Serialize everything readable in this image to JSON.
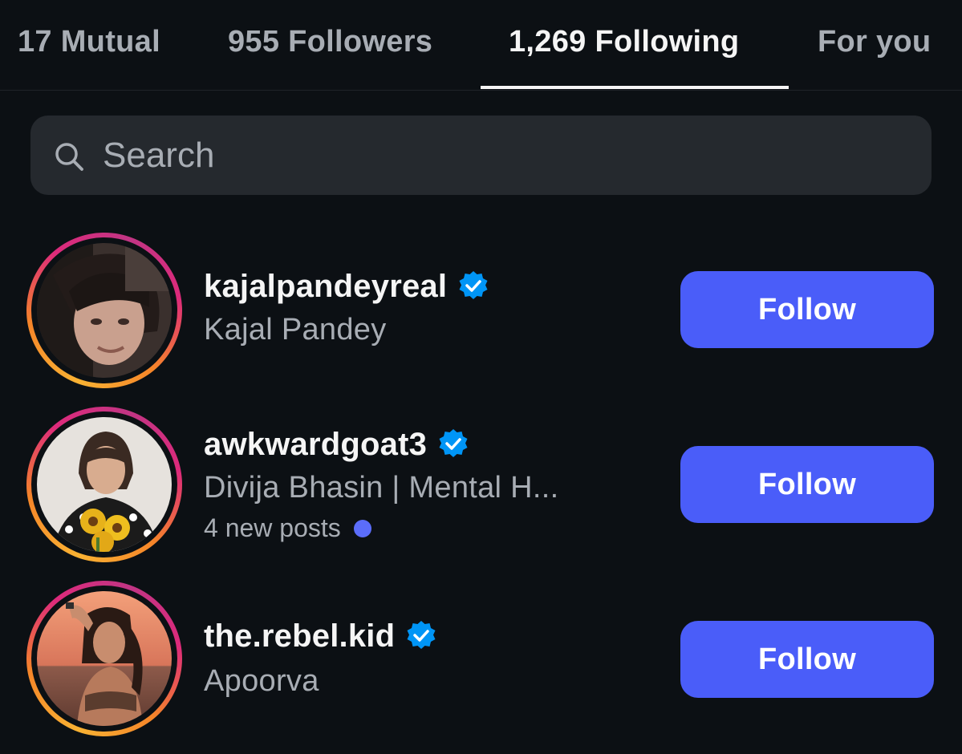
{
  "tabs": [
    {
      "label": "17 Mutual",
      "active": false
    },
    {
      "label": "955 Followers",
      "active": false
    },
    {
      "label": "1,269 Following",
      "active": true
    },
    {
      "label": "For you",
      "active": false
    }
  ],
  "search": {
    "placeholder": "Search",
    "value": ""
  },
  "accounts": [
    {
      "username": "kajalpandeyreal",
      "full_name": "Kajal Pandey",
      "verified": true,
      "status": "",
      "button_label": "Follow"
    },
    {
      "username": "awkwardgoat3",
      "full_name": "Divija Bhasin | Mental H...",
      "verified": true,
      "status": "4 new posts",
      "button_label": "Follow"
    },
    {
      "username": "the.rebel.kid",
      "full_name": "Apoorva",
      "verified": true,
      "status": "",
      "button_label": "Follow"
    }
  ],
  "colors": {
    "background": "#0c1014",
    "follow_button": "#4a5df9",
    "verified_badge": "#0095f6",
    "secondary_text": "#a8adb4",
    "new_post_dot": "#5b6dfa",
    "story_ring_start": "#f9b233",
    "story_ring_end": "#dd2a7b"
  },
  "icons": {
    "search": "search-icon",
    "verified": "verified-badge-icon",
    "new_posts": "dot-icon"
  }
}
